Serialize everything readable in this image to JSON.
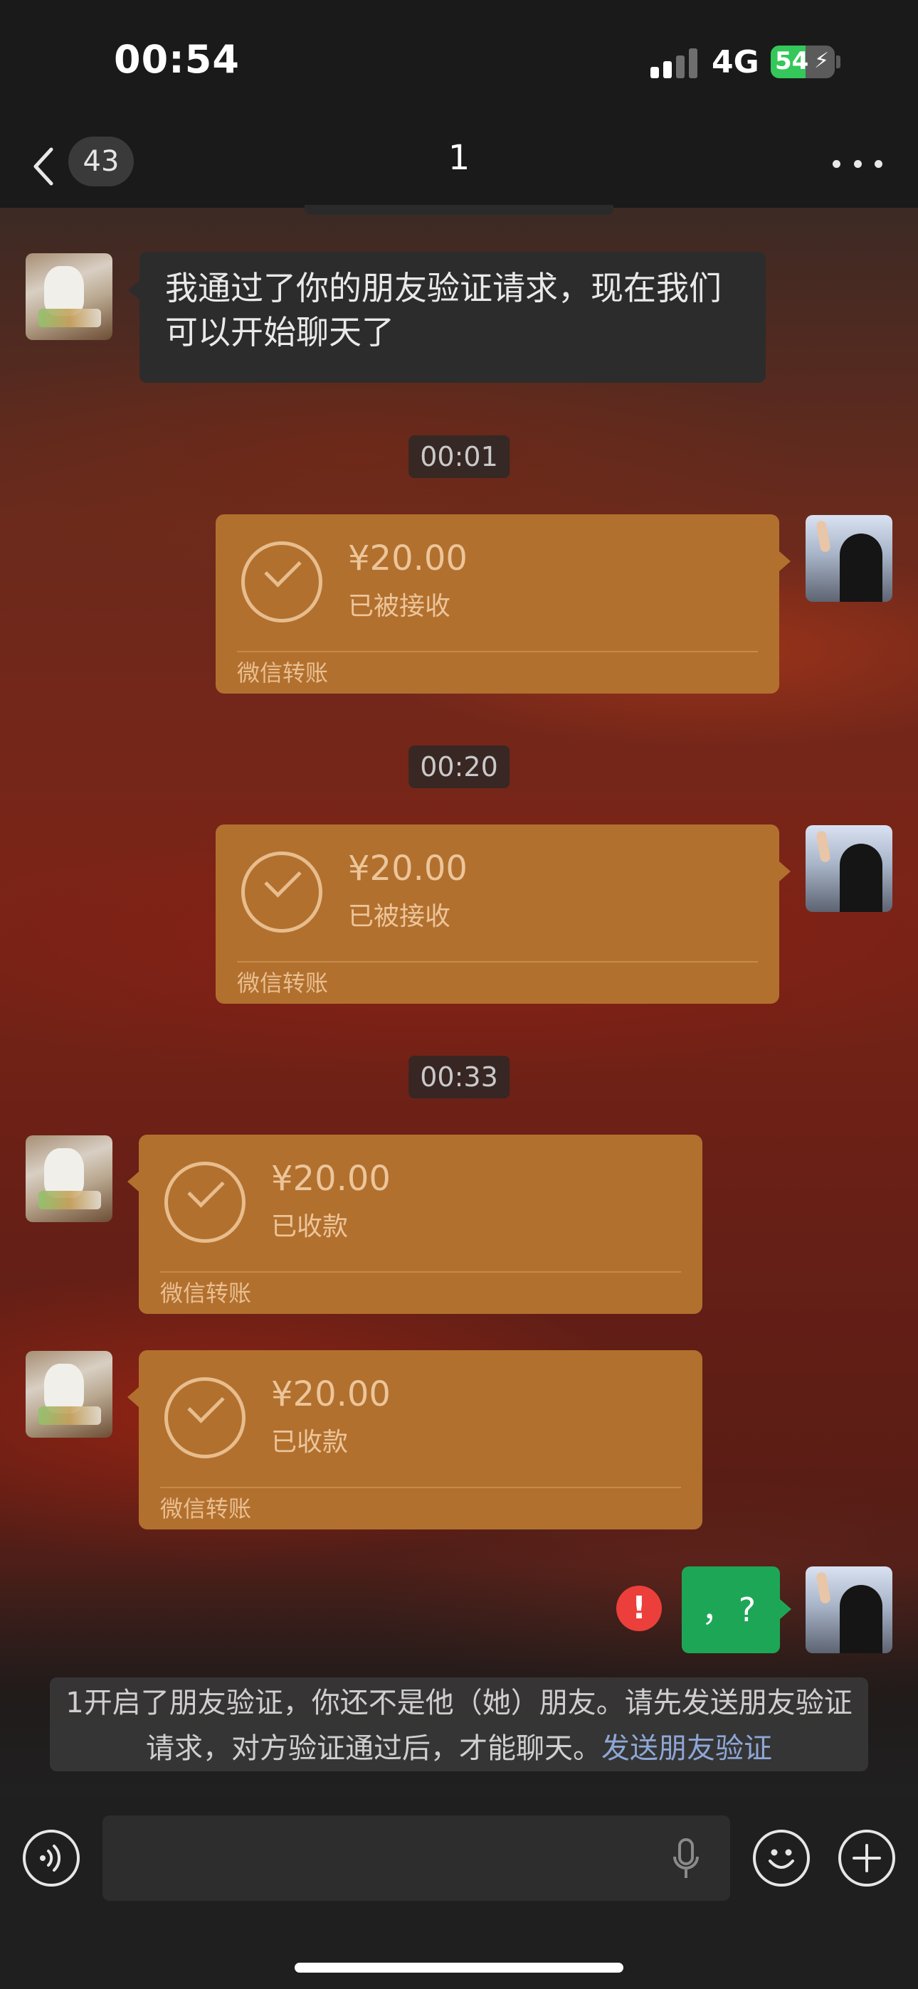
{
  "status_bar": {
    "time": "00:54",
    "network": "4G",
    "battery_level": "54",
    "battery_fraction": 0.54,
    "signal_bars_active": 2,
    "signal_bars_total": 4
  },
  "nav": {
    "back_count": "43",
    "title": "1",
    "more_icon": "more-dots-icon"
  },
  "messages": [
    {
      "type": "text",
      "side": "left",
      "text": "我通过了你的朋友验证请求，现在我们可以开始聊天了"
    },
    {
      "type": "timestamp",
      "text": "00:01"
    },
    {
      "type": "transfer",
      "side": "right",
      "amount": "¥20.00",
      "status": "已被接收",
      "brand": "微信转账"
    },
    {
      "type": "timestamp",
      "text": "00:20"
    },
    {
      "type": "transfer",
      "side": "right",
      "amount": "¥20.00",
      "status": "已被接收",
      "brand": "微信转账"
    },
    {
      "type": "timestamp",
      "text": "00:33"
    },
    {
      "type": "transfer",
      "side": "left",
      "amount": "¥20.00",
      "status": "已收款",
      "brand": "微信转账"
    },
    {
      "type": "transfer",
      "side": "left",
      "amount": "¥20.00",
      "status": "已收款",
      "brand": "微信转账"
    },
    {
      "type": "text",
      "side": "right",
      "text": "，?",
      "failed": true
    }
  ],
  "system_note": {
    "text": "1开启了朋友验证，你还不是他（她）朋友。请先发送朋友验证请求，对方验证通过后，才能聊天。",
    "link": "发送朋友验证"
  },
  "error_mark": "!",
  "input_bar": {
    "voice_icon": "voice-icon",
    "mic_icon": "microphone-icon",
    "emoji_icon": "emoji-icon",
    "plus_icon": "plus-icon"
  },
  "colors": {
    "transfer_card": "#b2702e",
    "sent_bubble": "#1ea657",
    "error": "#ec3f3b",
    "link": "#8ea7d6"
  }
}
